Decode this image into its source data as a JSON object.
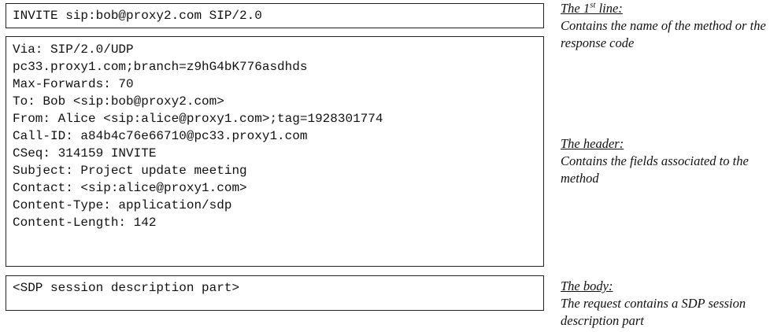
{
  "first_line": {
    "text": "INVITE sip:bob@proxy2.com SIP/2.0"
  },
  "header": {
    "lines": [
      "Via: SIP/2.0/UDP",
      "pc33.proxy1.com;branch=z9hG4bK776asdhds",
      "Max-Forwards: 70",
      "To: Bob <sip:bob@proxy2.com>",
      "From: Alice <sip:alice@proxy1.com>;tag=1928301774",
      "Call-ID: a84b4c76e66710@pc33.proxy1.com",
      "CSeq: 314159 INVITE",
      "Subject: Project update meeting",
      "Contact: <sip:alice@proxy1.com>",
      "Content-Type: application/sdp",
      "Content-Length: 142"
    ]
  },
  "body": {
    "text": "<SDP session description part>"
  },
  "annotations": {
    "first_line": {
      "title_prefix": "The 1",
      "title_sup": "st",
      "title_suffix": " line:",
      "desc": "Contains the name of the method or the response code"
    },
    "header": {
      "title": "The header:",
      "desc": "Contains the fields associated to the method"
    },
    "body": {
      "title": "The body:",
      "desc": "The request contains a SDP session description part"
    }
  }
}
